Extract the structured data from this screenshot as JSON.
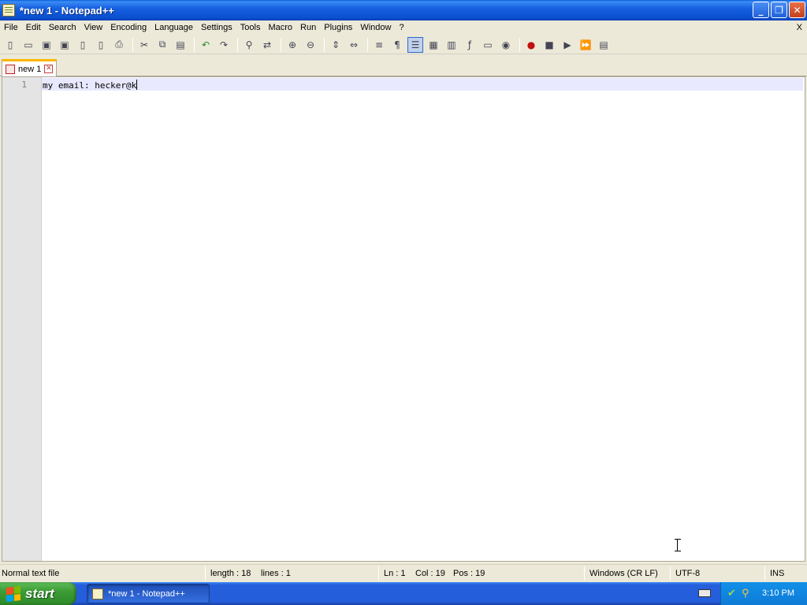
{
  "window": {
    "title": "*new 1 - Notepad++",
    "controls": {
      "minimize": "_",
      "restore": "❐",
      "close": "✕"
    }
  },
  "menu": {
    "items": [
      "File",
      "Edit",
      "Search",
      "View",
      "Encoding",
      "Language",
      "Settings",
      "Tools",
      "Macro",
      "Run",
      "Plugins",
      "Window",
      "?"
    ],
    "close_label": "X"
  },
  "toolbar": {
    "icons": [
      "new-file-icon",
      "open-file-icon",
      "save-icon",
      "save-all-icon",
      "close-icon",
      "close-all-icon",
      "print-icon",
      "cut-icon",
      "copy-icon",
      "paste-icon",
      "undo-icon",
      "redo-icon",
      "find-icon",
      "replace-icon",
      "zoom-in-icon",
      "zoom-out-icon",
      "sync-vertical-icon",
      "sync-horizontal-icon",
      "word-wrap-icon",
      "show-all-chars-icon",
      "indent-guide-icon",
      "user-defined-lang-icon",
      "doc-map-icon",
      "function-list-icon",
      "folder-workspace-icon",
      "monitoring-icon",
      "record-macro-icon",
      "stop-record-icon",
      "playback-macro-icon",
      "run-macro-multiple-icon",
      "save-macro-icon"
    ]
  },
  "tabs": [
    {
      "label": "new 1",
      "close": "✕"
    }
  ],
  "editor": {
    "line_number": "1",
    "text": "my email: hecker@k"
  },
  "statusbar": {
    "file_type": "Normal text file",
    "length": "length : 18",
    "lines": "lines : 1",
    "ln": "Ln : 1",
    "col": "Col : 19",
    "pos": "Pos : 19",
    "eol": "Windows (CR LF)",
    "encoding": "UTF-8",
    "mode": "INS"
  },
  "taskbar": {
    "start_label": "start",
    "task_label": "*new 1 - Notepad++",
    "clock": "3:10 PM"
  }
}
